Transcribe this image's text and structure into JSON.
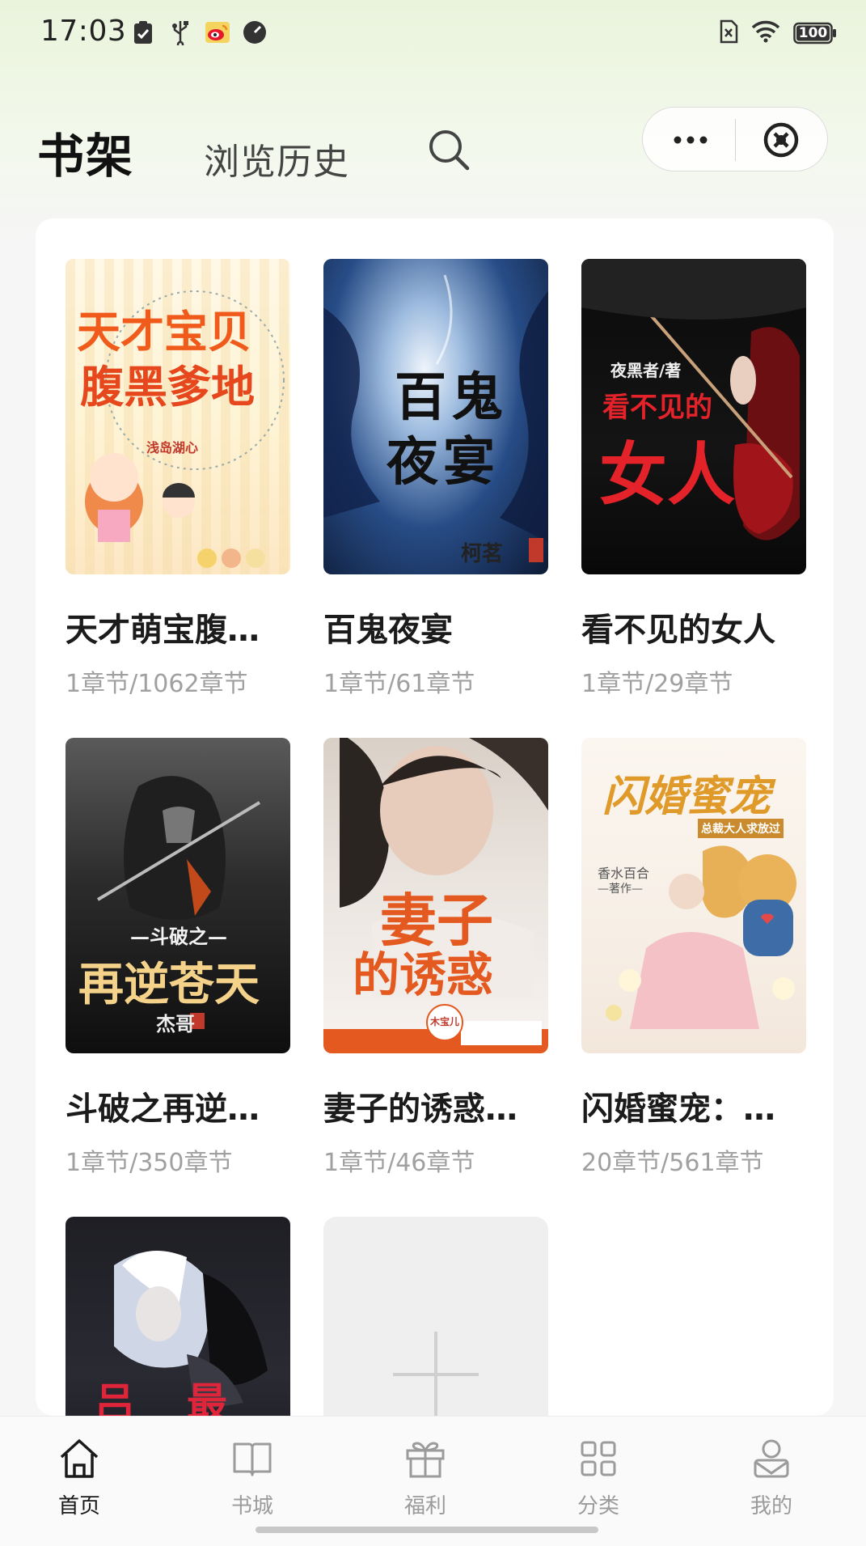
{
  "status_bar": {
    "time": "17:03",
    "battery": "100",
    "icons_left": [
      "clipboard-icon",
      "usb-icon",
      "weibo-icon",
      "speed-icon"
    ],
    "icons_right": [
      "sim-icon",
      "wifi-icon",
      "battery-icon"
    ]
  },
  "header": {
    "tab_shelf": "书架",
    "tab_history": "浏览历史"
  },
  "books": [
    {
      "title": "天才萌宝腹…",
      "progress": "1章节/1062章节",
      "cover_text": [
        "天才宝贝",
        "腹黑爹地",
        "浅岛湖心"
      ]
    },
    {
      "title": "百鬼夜宴",
      "progress": "1章节/61章节",
      "cover_text": [
        "百鬼",
        "夜宴",
        "柯茗"
      ]
    },
    {
      "title": "看不见的女人",
      "progress": "1章节/29章节",
      "cover_text": [
        "夜黑者/著",
        "看不见的",
        "女人"
      ]
    },
    {
      "title": "斗破之再逆…",
      "progress": "1章节/350章节",
      "cover_text": [
        "—斗破之—",
        "再逆苍天",
        "杰哥"
      ]
    },
    {
      "title": "妻子的诱惑…",
      "progress": "1章节/46章节",
      "cover_text": [
        "妻子",
        "的诱惑",
        "木宝儿"
      ]
    },
    {
      "title": "闪婚蜜宠：…",
      "progress": "20章节/561章节",
      "cover_text": [
        "闪婚蜜宠",
        "总裁大人求放过",
        "香水百合",
        "—著作—"
      ]
    },
    {
      "title": "",
      "progress": "",
      "cover_text": [
        "吕",
        "最"
      ]
    }
  ],
  "bottom_nav": [
    {
      "label": "首页",
      "icon": "home-icon",
      "active": true
    },
    {
      "label": "书城",
      "icon": "book-open-icon",
      "active": false
    },
    {
      "label": "福利",
      "icon": "gift-icon",
      "active": false
    },
    {
      "label": "分类",
      "icon": "grid-icon",
      "active": false
    },
    {
      "label": "我的",
      "icon": "user-icon",
      "active": false
    }
  ],
  "colors": {
    "accent_active": "#1a1a1a",
    "inactive": "#9b9b9b",
    "background": "#f6f6f6",
    "card": "#ffffff"
  }
}
